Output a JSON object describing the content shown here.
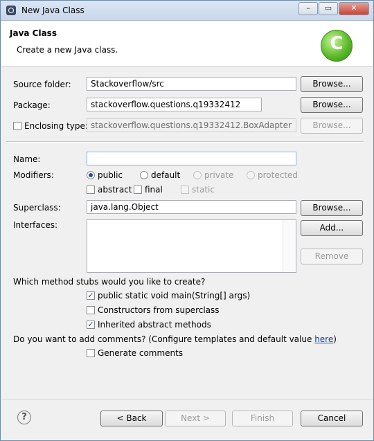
{
  "window": {
    "title": "New Java Class",
    "minimize": "–",
    "maximize": "▭",
    "close": "✕"
  },
  "banner": {
    "heading": "Java Class",
    "subtitle": "Create a new Java class.",
    "logo_letter": "C"
  },
  "source_folder": {
    "label": "Source folder:",
    "value": "Stackoverflow/src",
    "browse": "Browse..."
  },
  "package": {
    "label": "Package:",
    "value": "stackoverflow.questions.q19332412",
    "browse": "Browse..."
  },
  "enclosing_type": {
    "label": "Enclosing type:",
    "checked": false,
    "value": "stackoverflow.questions.q19332412.BoxAdapter",
    "browse": "Browse..."
  },
  "name": {
    "label": "Name:",
    "value": ""
  },
  "modifiers": {
    "label": "Modifiers:",
    "public": "public",
    "default": "default",
    "private": "private",
    "protected": "protected",
    "abstract": "abstract",
    "final": "final",
    "static": "static",
    "selected": "public"
  },
  "superclass": {
    "label": "Superclass:",
    "value": "java.lang.Object",
    "browse": "Browse..."
  },
  "interfaces": {
    "label": "Interfaces:",
    "add": "Add...",
    "remove": "Remove",
    "items": []
  },
  "stubs": {
    "question": "Which method stubs would you like to create?",
    "main": "public static void main(String[] args)",
    "constructors": "Constructors from superclass",
    "inherited": "Inherited abstract methods",
    "main_checked": "✓",
    "constructors_checked": "",
    "inherited_checked": "✓"
  },
  "comments": {
    "question_prefix": "Do you want to add comments? (Configure templates and default value ",
    "link": "here",
    "question_suffix": ")",
    "generate": "Generate comments",
    "generate_checked": ""
  },
  "footer": {
    "help": "?",
    "back": "< Back",
    "next": "Next >",
    "finish": "Finish",
    "cancel": "Cancel"
  }
}
